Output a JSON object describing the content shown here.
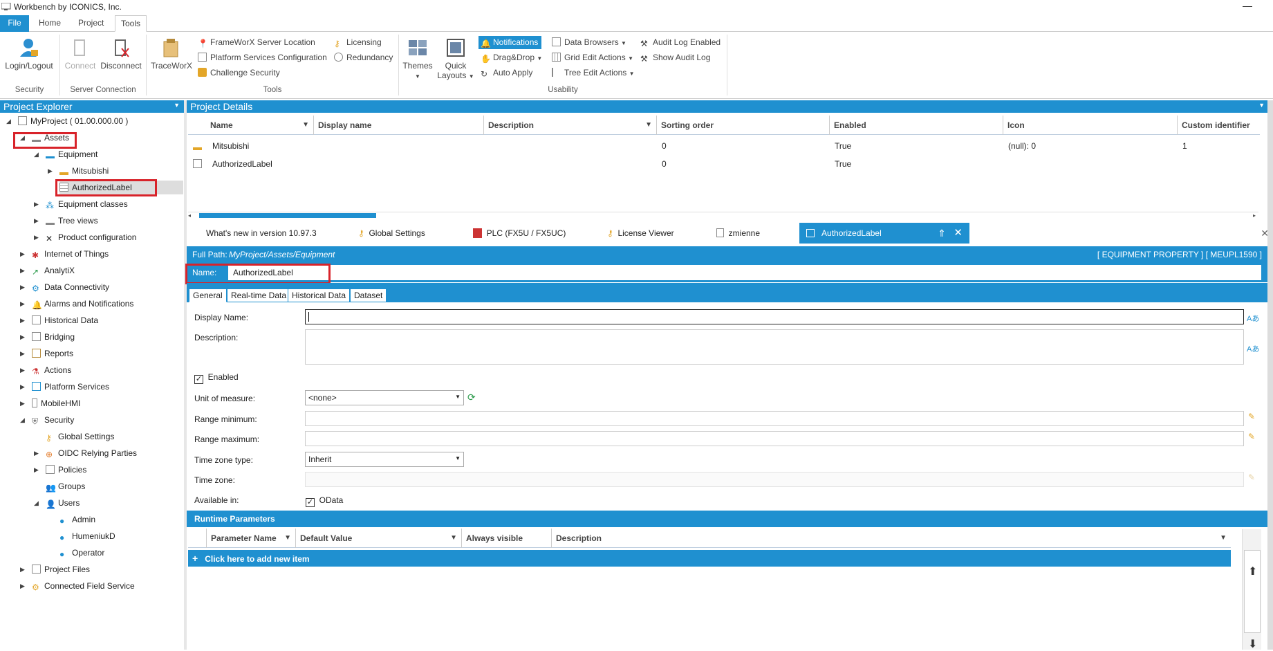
{
  "window": {
    "title": "Workbench by ICONICS, Inc.",
    "minimize": "—"
  },
  "menu_tabs": [
    "File",
    "Home",
    "Project",
    "Tools"
  ],
  "ribbon": {
    "security": {
      "label": "Security",
      "login": "Login/Logout"
    },
    "server": {
      "label": "Server Connection",
      "connect": "Connect",
      "disconnect": "Disconnect"
    },
    "tools": {
      "label": "Tools",
      "traceworx": "TraceWorX",
      "frameworx": "FrameWorX Server Location",
      "platform": "Platform Services Configuration",
      "challenge": "Challenge Security",
      "licensing": "Licensing",
      "redundancy": "Redundancy"
    },
    "usability": {
      "label": "Usability",
      "themes": "Themes",
      "quick1": "Quick",
      "quick2": "Layouts",
      "notifications": "Notifications",
      "dragdrop": "Drag&Drop",
      "autoapply": "Auto Apply",
      "databrowsers": "Data Browsers",
      "gridedit": "Grid Edit Actions",
      "treeedit": "Tree Edit Actions",
      "auditenabled": "Audit Log Enabled",
      "showaudit": "Show Audit Log"
    }
  },
  "explorer": {
    "title": "Project Explorer",
    "nodes": [
      "MyProject ( 01.00.000.00 )",
      "Assets",
      "Equipment",
      "Mitsubishi",
      "AuthorizedLabel",
      "Equipment classes",
      "Tree views",
      "Product configuration",
      "Internet of Things",
      "AnalytiX",
      "Data Connectivity",
      "Alarms and Notifications",
      "Historical Data",
      "Bridging",
      "Reports",
      "Actions",
      "Platform Services",
      "MobileHMI",
      "Security",
      "Global Settings",
      "OIDC Relying Parties",
      "Policies",
      "Groups",
      "Users",
      "Admin",
      "HumeniukD",
      "Operator",
      "Project Files",
      "Connected Field Service"
    ]
  },
  "details": {
    "title": "Project Details",
    "columns": [
      "Name",
      "Display name",
      "Description",
      "Sorting order",
      "Enabled",
      "Icon",
      "Custom identifier"
    ],
    "rows": [
      [
        "Mitsubishi",
        "",
        "",
        "0",
        "True",
        "(null): 0",
        "1"
      ],
      [
        "AuthorizedLabel",
        "",
        "",
        "0",
        "True",
        "",
        ""
      ]
    ]
  },
  "doc_tabs": [
    "What's new in version 10.97.3",
    "Global Settings",
    "PLC (FX5U / FX5UC)",
    "License Viewer",
    "zmienne",
    "AuthorizedLabel"
  ],
  "editor": {
    "full_path_label": "Full Path:",
    "full_path": "MyProject/Assets/Equipment",
    "type": "[ EQUIPMENT PROPERTY ] [ MEUPL1590 ]",
    "name_label": "Name:",
    "name_value": "AuthorizedLabel",
    "subtabs": [
      "General",
      "Real-time Data",
      "Historical Data",
      "Dataset"
    ],
    "fields": {
      "display_name": "Display Name:",
      "description": "Description:",
      "enabled": "Enabled",
      "unit": "Unit of measure:",
      "unit_value": "<none>",
      "range_min": "Range minimum:",
      "range_max": "Range maximum:",
      "tz_type": "Time zone type:",
      "tz_type_value": "Inherit",
      "tz": "Time zone:",
      "available": "Available in:",
      "odata": "OData"
    },
    "runtime": {
      "title": "Runtime Parameters",
      "columns": [
        "Parameter Name",
        "Default Value",
        "Always visible",
        "Description"
      ],
      "add": "Click here to add new item"
    }
  },
  "colors": {
    "accent": "#1f90d0",
    "highlight": "#d8232a"
  }
}
